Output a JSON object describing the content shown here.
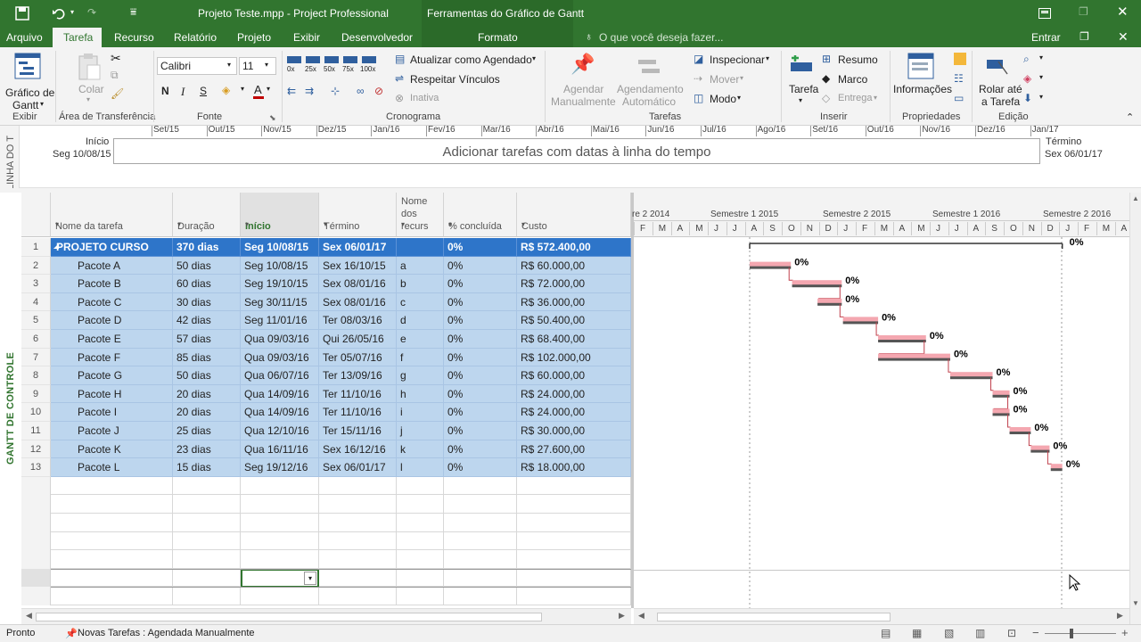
{
  "titlebar": {
    "title": "Projeto Teste.mpp - Project Professional",
    "context_tab_group": "Ferramentas do Gráfico de Gantt"
  },
  "tabs": [
    "Arquivo",
    "Tarefa",
    "Recurso",
    "Relatório",
    "Projeto",
    "Exibir",
    "Desenvolvedor",
    "Formato"
  ],
  "search_placeholder": "O que você deseja fazer...",
  "signin": "Entrar",
  "ribbon": {
    "gantt_btn": [
      "Gráfico de",
      "Gantt"
    ],
    "paste": "Colar",
    "font_name": "Calibri",
    "font_size": "11",
    "bold": "N",
    "italic": "I",
    "underline": "S",
    "pct_buttons": [
      "0x",
      "25x",
      "50x",
      "75x",
      "100x"
    ],
    "update_schedule": "Atualizar como Agendado",
    "respect_links": "Respeitar Vínculos",
    "inactive": "Inativa",
    "manual": [
      "Agendar",
      "Manualmente"
    ],
    "auto": [
      "Agendamento",
      "Automático"
    ],
    "inspect": "Inspecionar",
    "move": "Mover",
    "mode": "Modo",
    "task": "Tarefa",
    "summary": "Resumo",
    "milestone": "Marco",
    "deliverable": "Entrega",
    "info": "Informações",
    "scroll": [
      "Rolar até",
      "a Tarefa"
    ],
    "groups": [
      "Exibir",
      "Área de Transferência",
      "Fonte",
      "Cronograma",
      "Tarefas",
      "Inserir",
      "Propriedades",
      "Edição"
    ]
  },
  "timeline": {
    "side_label": "LINHA DO T",
    "start_label": "Início",
    "start_date": "Seg 10/08/15",
    "end_label": "Término",
    "end_date": "Sex 06/01/17",
    "placeholder": "Adicionar tarefas com datas à linha do tempo",
    "months": [
      "Set/15",
      "Out/15",
      "Nov/15",
      "Dez/15",
      "Jan/16",
      "Fev/16",
      "Mar/16",
      "Abr/16",
      "Mai/16",
      "Jun/16",
      "Jul/16",
      "Ago/16",
      "Set/16",
      "Out/16",
      "Nov/16",
      "Dez/16",
      "Jan/17"
    ]
  },
  "view_label": "GANTT DE CONTROLE",
  "columns": [
    "Nome da tarefa",
    "Duração",
    "Início",
    "Término",
    "Nome dos recurs",
    "% concluída",
    "Custo"
  ],
  "tasks": [
    {
      "id": "1",
      "name": "PROJETO CURSO",
      "dur": "370 dias",
      "start": "Seg 10/08/15",
      "end": "Sex 06/01/17",
      "res": "",
      "pct": "0%",
      "cost": "R$ 572.400,00",
      "summary": true
    },
    {
      "id": "2",
      "name": "Pacote A",
      "dur": "50 dias",
      "start": "Seg 10/08/15",
      "end": "Sex 16/10/15",
      "res": "a",
      "pct": "0%",
      "cost": "R$ 60.000,00"
    },
    {
      "id": "3",
      "name": "Pacote B",
      "dur": "60 dias",
      "start": "Seg 19/10/15",
      "end": "Sex 08/01/16",
      "res": "b",
      "pct": "0%",
      "cost": "R$ 72.000,00"
    },
    {
      "id": "4",
      "name": "Pacote C",
      "dur": "30 dias",
      "start": "Seg 30/11/15",
      "end": "Sex 08/01/16",
      "res": "c",
      "pct": "0%",
      "cost": "R$ 36.000,00"
    },
    {
      "id": "5",
      "name": "Pacote D",
      "dur": "42 dias",
      "start": "Seg 11/01/16",
      "end": "Ter 08/03/16",
      "res": "d",
      "pct": "0%",
      "cost": "R$ 50.400,00"
    },
    {
      "id": "6",
      "name": "Pacote E",
      "dur": "57 dias",
      "start": "Qua 09/03/16",
      "end": "Qui 26/05/16",
      "res": "e",
      "pct": "0%",
      "cost": "R$ 68.400,00"
    },
    {
      "id": "7",
      "name": "Pacote F",
      "dur": "85 dias",
      "start": "Qua 09/03/16",
      "end": "Ter 05/07/16",
      "res": "f",
      "pct": "0%",
      "cost": "R$ 102.000,00"
    },
    {
      "id": "8",
      "name": "Pacote G",
      "dur": "50 dias",
      "start": "Qua 06/07/16",
      "end": "Ter 13/09/16",
      "res": "g",
      "pct": "0%",
      "cost": "R$ 60.000,00"
    },
    {
      "id": "9",
      "name": "Pacote H",
      "dur": "20 dias",
      "start": "Qua 14/09/16",
      "end": "Ter 11/10/16",
      "res": "h",
      "pct": "0%",
      "cost": "R$ 24.000,00"
    },
    {
      "id": "10",
      "name": "Pacote I",
      "dur": "20 dias",
      "start": "Qua 14/09/16",
      "end": "Ter 11/10/16",
      "res": "i",
      "pct": "0%",
      "cost": "R$ 24.000,00"
    },
    {
      "id": "11",
      "name": "Pacote J",
      "dur": "25 dias",
      "start": "Qua 12/10/16",
      "end": "Ter 15/11/16",
      "res": "j",
      "pct": "0%",
      "cost": "R$ 30.000,00"
    },
    {
      "id": "12",
      "name": "Pacote K",
      "dur": "23 dias",
      "start": "Qua 16/11/16",
      "end": "Sex 16/12/16",
      "res": "k",
      "pct": "0%",
      "cost": "R$ 27.600,00"
    },
    {
      "id": "13",
      "name": "Pacote L",
      "dur": "15 dias",
      "start": "Seg 19/12/16",
      "end": "Sex 06/01/17",
      "res": "l",
      "pct": "0%",
      "cost": "R$ 18.000,00"
    }
  ],
  "gantt": {
    "semesters": [
      "re 2 2014",
      "Semestre 1 2015",
      "Semestre 2 2015",
      "Semestre 1 2016",
      "Semestre 2 2016"
    ],
    "months": [
      "F",
      "M",
      "A",
      "M",
      "J",
      "J",
      "A",
      "S",
      "O",
      "N",
      "D",
      "J",
      "F",
      "M",
      "A",
      "M",
      "J",
      "J",
      "A",
      "S",
      "O",
      "N",
      "D",
      "J",
      "F",
      "M",
      "A"
    ],
    "bar_color": "#f4a7b0",
    "bar_border": "#c0404c",
    "summary_color": "#333333"
  },
  "status": {
    "ready": "Pronto",
    "new_tasks": "Novas Tarefas : Agendada Manualmente"
  },
  "colors": {
    "ribbon_green": "#31752f",
    "selected_row": "#2e75c9",
    "row_highlight": "#bdd6ee"
  }
}
